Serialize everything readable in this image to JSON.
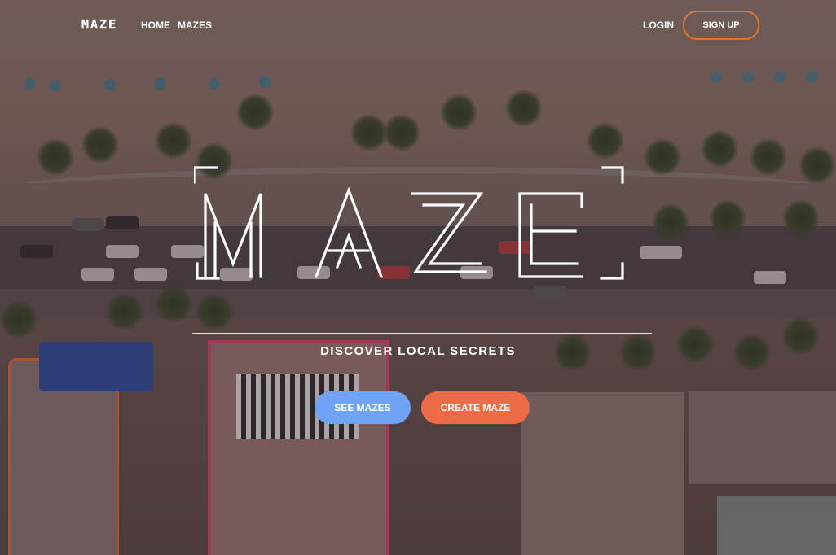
{
  "nav": {
    "brand": "MAZE",
    "home": "HOME",
    "mazes": "MAZES",
    "login": "LOGIN",
    "signup": "SIGN UP"
  },
  "hero": {
    "title": "MAZE",
    "tagline": "DISCOVER LOCAL SECRETS",
    "see_mazes": "SEE MAZES",
    "create_maze": "CREATE MAZE"
  },
  "colors": {
    "signup_border": "#e0762f",
    "see_mazes_bg": "#6fa3f5",
    "create_maze_bg": "#ee6b48"
  }
}
